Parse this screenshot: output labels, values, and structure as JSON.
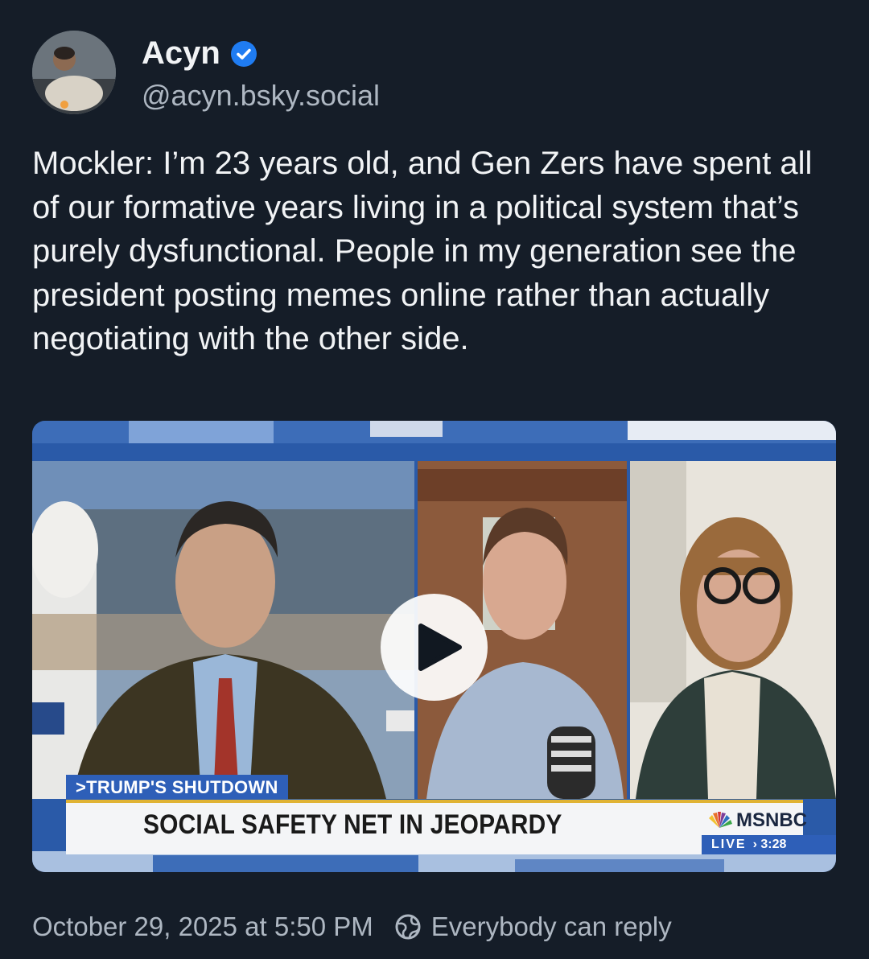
{
  "author": {
    "display_name": "Acyn",
    "handle": "@acyn.bsky.social",
    "verified_icon": "verified-check-icon",
    "avatar_icon": "profile-photo"
  },
  "post": {
    "text": "Mockler: I’m 23 years old, and Gen Zers have spent all of our formative years living in a political system that’s purely dysfunctional. People in my generation see the president posting memes online rather than actually negotiating with the other side."
  },
  "video": {
    "play_icon": "play-icon",
    "overlay": {
      "tag": ">TRUMP'S SHUTDOWN",
      "headline": "SOCIAL SAFETY NET IN JEOPARDY",
      "network": "MSNBC",
      "live": "LIVE",
      "time": "› 3:28"
    }
  },
  "footer": {
    "timestamp": "October 29, 2025 at 5:50 PM",
    "reply_setting": "Everybody can reply",
    "reply_icon": "globe-icon"
  },
  "colors": {
    "background": "#151d28",
    "accent": "#1f7cf2",
    "muted_text": "#aeb7c2"
  }
}
